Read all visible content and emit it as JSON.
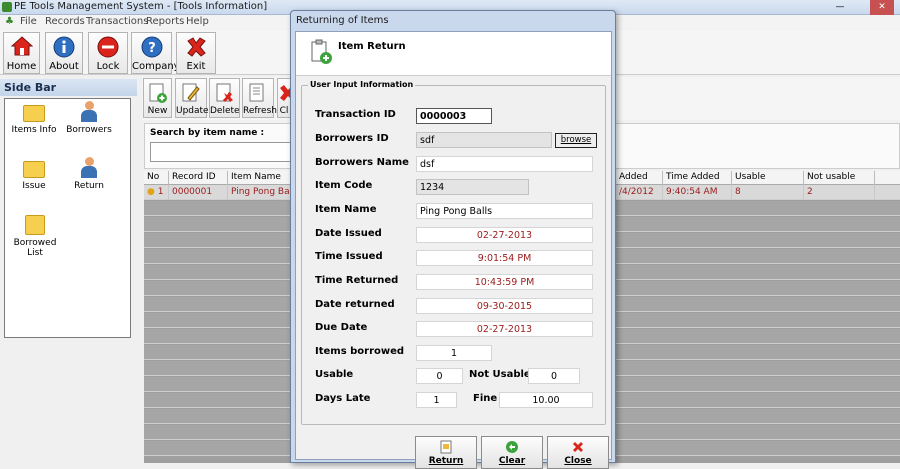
{
  "window": {
    "title": "PE Tools Management System - [Tools Information]",
    "minimize": "—",
    "close": "✕"
  },
  "menu": [
    "File",
    "Records",
    "Transactions",
    "Reports",
    "Help"
  ],
  "toolbar": {
    "home": "Home",
    "about": "About",
    "lock": "Lock",
    "company": "Company",
    "exit": "Exit"
  },
  "sidebar": {
    "title": "Side Bar",
    "items": [
      {
        "label": "Items Info"
      },
      {
        "label": "Borrowers"
      },
      {
        "label": "Issue"
      },
      {
        "label": "Return"
      },
      {
        "label": "Borrowed List"
      }
    ]
  },
  "tools_toolbar": {
    "new": "New",
    "update": "Update",
    "delete": "Delete",
    "refresh": "Refresh",
    "close_partial": "Cl"
  },
  "search": {
    "label": "Search by item name :",
    "value": ""
  },
  "grid": {
    "columns": [
      "No",
      "Record ID",
      "Item Name",
      "Added",
      "Time Added",
      "Usable",
      "Not usable"
    ],
    "rows": [
      {
        "no": "1",
        "record_id": "0000001",
        "item_name": "Ping Pong Balls",
        "date_added": "/4/2012",
        "time_added": "9:40:54 AM",
        "usable": "8",
        "not_usable": "2"
      }
    ]
  },
  "dialog": {
    "title": "Returning of Items",
    "header": "Item Return",
    "group_title": "User Input Information",
    "fields": {
      "transaction_id": {
        "label": "Transaction ID",
        "value": "0000003"
      },
      "borrowers_id": {
        "label": "Borrowers ID",
        "value": "sdf"
      },
      "browse": "browse",
      "borrowers_name": {
        "label": "Borrowers Name",
        "value": "dsf"
      },
      "item_code": {
        "label": "Item Code",
        "value": "1234"
      },
      "item_name": {
        "label": "Item Name",
        "value": "Ping Pong Balls"
      },
      "date_issued": {
        "label": "Date Issued",
        "value": "02-27-2013"
      },
      "time_issued": {
        "label": "Time Issued",
        "value": "9:01:54 PM"
      },
      "time_returned": {
        "label": "Time Returned",
        "value": "10:43:59 PM"
      },
      "date_returned": {
        "label": "Date returned",
        "value": "09-30-2015"
      },
      "due_date": {
        "label": "Due Date",
        "value": "02-27-2013"
      },
      "items_borrowed": {
        "label": "Items borrowed",
        "value": "1"
      },
      "usable": {
        "label": "Usable",
        "value": "0"
      },
      "not_usable": {
        "label": "Not Usable",
        "value": "0"
      },
      "days_late": {
        "label": "Days Late",
        "value": "1"
      },
      "fine": {
        "label": "Fine",
        "value": "10.00"
      }
    },
    "buttons": {
      "return": "Return",
      "clear": "Clear",
      "close": "Close"
    }
  },
  "colors": {
    "accent": "#3b72b3",
    "data_text": "#9b1b1b",
    "exit_red": "#d9251c"
  }
}
